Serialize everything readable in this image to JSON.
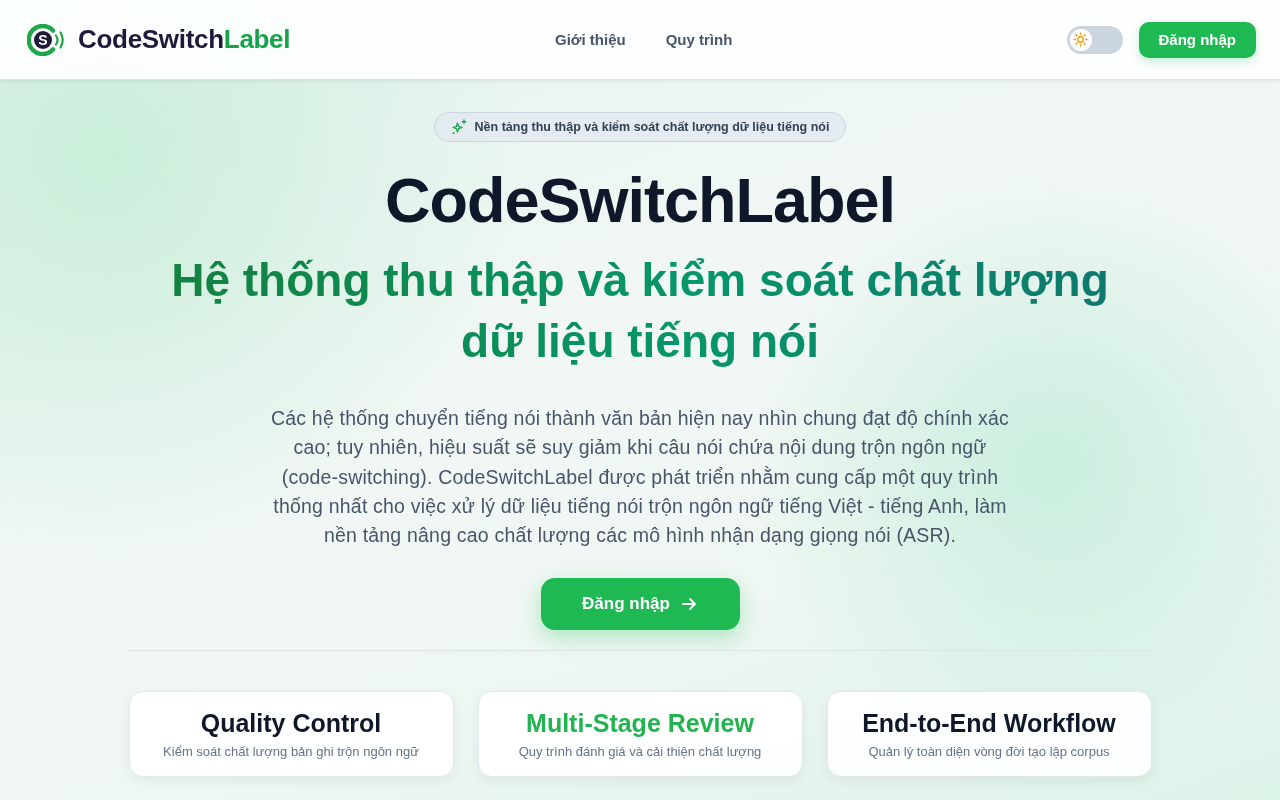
{
  "header": {
    "brand": {
      "logo_letter": "S",
      "name": "CodeSwitch",
      "accent": "Label"
    },
    "nav": [
      "Giới thiệu",
      "Quy trình"
    ],
    "theme_toggle": {
      "on": false
    },
    "login_button": "Đăng nhập"
  },
  "hero": {
    "badge": "Nền tảng thu thập và kiểm soát chất lượng dữ liệu tiếng nói",
    "title": "CodeSwitchLabel",
    "subtitle": "Hệ thống thu thập và kiểm soát chất lượng dữ liệu tiếng nói",
    "description": "Các hệ thống chuyển tiếng nói thành văn bản hiện nay nhìn chung đạt độ chính xác cao; tuy nhiên, hiệu suất sẽ suy giảm khi câu nói chứa nội dung trộn ngôn ngữ (code-switching). CodeSwitchLabel được phát triển nhằm cung cấp một quy trình thống nhất cho việc xử lý dữ liệu tiếng nói trộn ngôn ngữ tiếng Việt - tiếng Anh, làm nền tảng nâng cao chất lượng các mô hình nhận dạng giọng nói (ASR).",
    "cta_button": "Đăng nhập"
  },
  "features": [
    {
      "title": "Quality Control",
      "subtitle": "Kiểm soát chất lượng bản ghi trộn ngôn ngữ",
      "highlighted": false
    },
    {
      "title": "Multi-Stage Review",
      "subtitle": "Quy trình đánh giá và cải thiện chất lượng",
      "highlighted": true
    },
    {
      "title": "End-to-End Workflow",
      "subtitle": "Quản lý toàn diện vòng đời tạo lập corpus",
      "highlighted": false
    }
  ]
}
